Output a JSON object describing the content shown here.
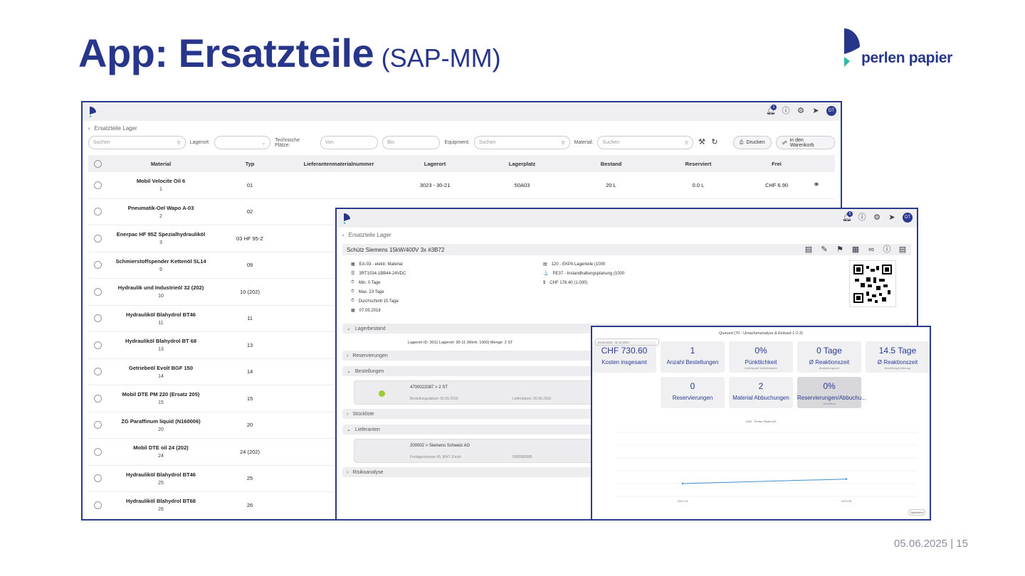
{
  "slide": {
    "title_main": "App: Ersatzteile",
    "title_sub": "(SAP-MM)",
    "footer": "05.06.2025 | 15",
    "logo_text": "perlen papier"
  },
  "colors": {
    "brand": "#27368a",
    "accent_green": "#9acd32",
    "teal": "#2fb8a8"
  },
  "list_window": {
    "breadcrumb": "Ersatzteile Lager",
    "notification_count": "1",
    "avatar_initials": "DT",
    "filters": {
      "search_placeholder": "Suchen",
      "lagerort_label": "Lagerort:",
      "tech_platz_label": "Technische Plätze:",
      "von_placeholder": "Von",
      "bis_placeholder": "Bis",
      "equipment_label": "Equipment:",
      "equipment_placeholder": "Suchen",
      "material_label": "Material:",
      "material_placeholder": "Suchen",
      "print_label": "Drucken",
      "cart_label": "in den Warenkorb"
    },
    "columns": [
      "Material",
      "Typ",
      "Lieferantenmaterialnummer",
      "Lagerort",
      "Lagerplatz",
      "Bestand",
      "Reserviert",
      "Frei"
    ],
    "rows": [
      {
        "name": "Mobil Velocite Oil 6",
        "num": "1",
        "typ": "01",
        "lagerort": "3023 - 30-21",
        "lagerplatz": "50A03",
        "bestand": "20 L",
        "reserviert": "0.0 L",
        "frei": "CHF 6.90"
      },
      {
        "name": "Pneumatik-Oel Wapo A-03",
        "num": "2",
        "typ": "02",
        "lagerort": "",
        "lagerplatz": "",
        "bestand": "",
        "reserviert": "",
        "frei": ""
      },
      {
        "name": "Enerpac HF 95Z Spezialhydrauliköl",
        "num": "3",
        "typ": "03 HF 95-Z",
        "lagerort": "",
        "lagerplatz": "",
        "bestand": "",
        "reserviert": "",
        "frei": ""
      },
      {
        "name": "Schmierstoffspender Kettenöl SL14",
        "num": "9",
        "typ": "09",
        "lagerort": "",
        "lagerplatz": "",
        "bestand": "",
        "reserviert": "",
        "frei": ""
      },
      {
        "name": "Hydraulik und Industrieöl 32 (202)",
        "num": "10",
        "typ": "10 (202)",
        "lagerort": "",
        "lagerplatz": "",
        "bestand": "",
        "reserviert": "",
        "frei": ""
      },
      {
        "name": "Hydrauliköl Blahydrol BT46",
        "num": "11",
        "typ": "11",
        "lagerort": "",
        "lagerplatz": "",
        "bestand": "",
        "reserviert": "",
        "frei": ""
      },
      {
        "name": "Hydrauliköl Blahydrol BT 68",
        "num": "13",
        "typ": "13",
        "lagerort": "",
        "lagerplatz": "",
        "bestand": "",
        "reserviert": "",
        "frei": ""
      },
      {
        "name": "Getriebeöl Evolt BGF 150",
        "num": "14",
        "typ": "14",
        "lagerort": "",
        "lagerplatz": "",
        "bestand": "",
        "reserviert": "",
        "frei": ""
      },
      {
        "name": "Mobil DTE PM 220 (Ersatz 205)",
        "num": "15",
        "typ": "15",
        "lagerort": "",
        "lagerplatz": "",
        "bestand": "",
        "reserviert": "",
        "frei": ""
      },
      {
        "name": "ZG Paraffinum liquid (N160006)",
        "num": "20",
        "typ": "20",
        "lagerort": "",
        "lagerplatz": "",
        "bestand": "",
        "reserviert": "",
        "frei": ""
      },
      {
        "name": "Mobil DTE oil 24 (202)",
        "num": "24",
        "typ": "24 (202)",
        "lagerort": "",
        "lagerplatz": "",
        "bestand": "",
        "reserviert": "",
        "frei": ""
      },
      {
        "name": "Hydrauliköl Blahydrol BT46",
        "num": "25",
        "typ": "25",
        "lagerort": "",
        "lagerplatz": "",
        "bestand": "",
        "reserviert": "",
        "frei": ""
      },
      {
        "name": "Hydrauliköl Blahydrol BT68",
        "num": "26",
        "typ": "26",
        "lagerort": "",
        "lagerplatz": "",
        "bestand": "",
        "reserviert": "",
        "frei": ""
      }
    ]
  },
  "detail_window": {
    "breadcrumb": "Ersatzteile Lager",
    "notification_count": "5",
    "avatar_initials": "DT",
    "title": "Schütz Siemens 15kW/400V 3x #3B72",
    "left_fields": [
      "EA-03 - elektr. Material",
      "3RT1034-1BB44-24VDC",
      "Min. 0 Tage",
      "Max. 23 Tage",
      "Durchschnitt 15 Tage",
      "07.05.2018"
    ],
    "right_fields": [
      "120 - EKPA Lagerteile (1000",
      "PE37 - Instandhaltungsplanung (1000",
      "CHF 176.40 (1.000)"
    ],
    "sections": {
      "lagerbestand": "Lagerbestand",
      "lager_line": "Lagerort ID: 3011   Lagerort: 30-11   (Werk: 1000)   Menge: 2 ST",
      "reservierungen": "Reservierungen",
      "bestellungen": "Bestellungen",
      "bestellung_nr": "4700022087  >  2 ST",
      "bestellung_date1": "Bestellungsdatum: 02.05.2016",
      "bestellung_date2": "Lieferdatum: 06.05.2016",
      "stueckliste": "Stückliste",
      "lieferanten": "Lieferanten",
      "lieferant_name": "200002  >  Siemens Schweiz AG",
      "lieferant_addr": "Freilagerstrasse 40, 8047 Zürich",
      "lieferant_tel": "0585585585",
      "risikoanalyse": "Risikoanalyse"
    }
  },
  "kpi_window": {
    "title": "Queued (70 - Ursachenanalyse & Einkauf 1-2-3)",
    "date_range": "01.01.2020 - 31.12.2023",
    "kpis_row1": [
      {
        "value": "CHF 730.60",
        "label": "Kosten insgesamt",
        "sub": ""
      },
      {
        "value": "1",
        "label": "Anzahl Bestellungen",
        "sub": ""
      },
      {
        "value": "0%",
        "label": "Pünktlichkeit",
        "sub": "Lieferquote Vorlieferanten"
      },
      {
        "value": "0 Tage",
        "label": "Ø Reaktionszeit",
        "sub": "Abwicklungszeit"
      },
      {
        "value": "14.5 Tage",
        "label": "Ø Reaktionszeit",
        "sub": "Bestellung/Lieferung"
      }
    ],
    "kpis_row2": [
      {
        "value": "0",
        "label": "Reservierungen",
        "sub": ""
      },
      {
        "value": "2",
        "label": "Material Abbuchungen",
        "sub": ""
      },
      {
        "value": "0%",
        "label": "Reservierungen/Abbuchu...",
        "sub": "Verhältnis"
      }
    ],
    "chart_title": "1000 - Perlen Papier AG",
    "save_label": "Speichern"
  },
  "chart_data": {
    "type": "line",
    "title": "1000 - Perlen Papier AG",
    "x": [
      "2020-03",
      "2023-08"
    ],
    "series": [
      {
        "values": [
          20,
          27
        ]
      }
    ],
    "ylim": [
      0,
      100
    ],
    "grid": true
  }
}
